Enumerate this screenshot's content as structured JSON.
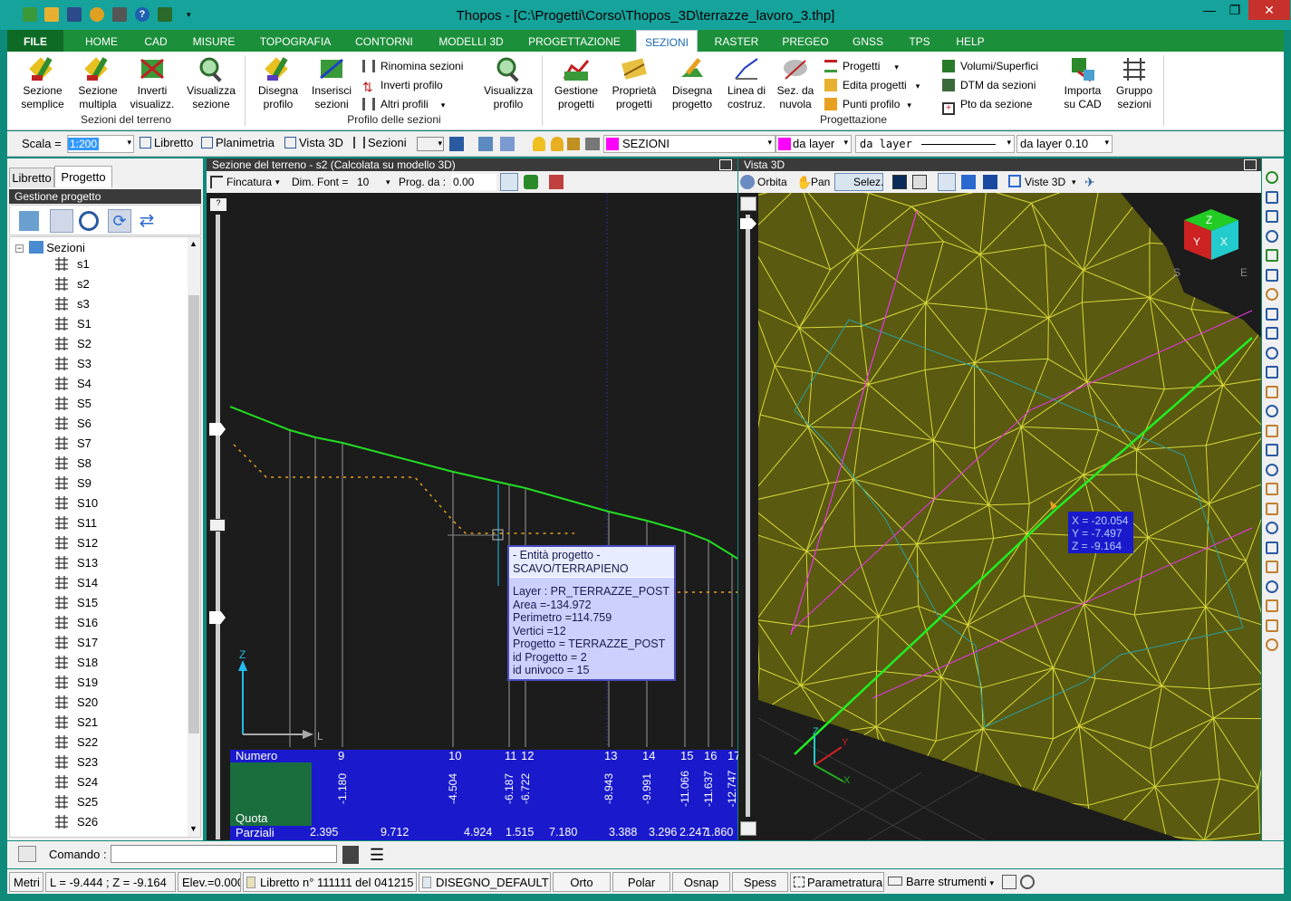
{
  "app": {
    "title": "Thopos - [C:\\Progetti\\Corso\\Thopos_3D\\terrazze_lavoro_3.thp]"
  },
  "window_controls": {
    "minimize": "—",
    "restore": "❐",
    "close": "✕"
  },
  "menu": {
    "tabs": [
      "FILE",
      "HOME",
      "CAD",
      "MISURE",
      "TOPOGRAFIA",
      "CONTORNI",
      "MODELLI 3D",
      "PROGETTAZIONE",
      "SEZIONI",
      "RASTER",
      "PREGEO",
      "GNSS",
      "TPS",
      "HELP"
    ],
    "active": "SEZIONI"
  },
  "ribbon": {
    "g1": {
      "label": "Sezioni del terreno",
      "buttons": [
        [
          "Sezione",
          "semplice"
        ],
        [
          "Sezione",
          "multipla"
        ],
        [
          "Inverti",
          "visualizz."
        ],
        [
          "Visualizza",
          "sezione"
        ]
      ]
    },
    "g2": {
      "label": "Profilo delle sezioni",
      "buttons": [
        [
          "Disegna",
          "profilo"
        ],
        [
          "Inserisci",
          "sezioni"
        ]
      ],
      "small": [
        "Rinomina sezioni",
        "Inverti profilo",
        "Altri profili"
      ],
      "buttons2": [
        [
          "Visualizza",
          "profilo"
        ]
      ]
    },
    "g3": {
      "label": "Progettazione",
      "buttons": [
        [
          "Gestione",
          "progetti"
        ],
        [
          "Proprietà",
          "progetti"
        ],
        [
          "Disegna",
          "progetto"
        ],
        [
          "Linea di",
          "costruz."
        ],
        [
          "Sez. da",
          "nuvola"
        ]
      ],
      "small1": [
        "Progetti",
        "Edita progetti",
        "Punti profilo"
      ],
      "small2": [
        "Volumi/Superfici",
        "DTM da sezioni",
        "Pto da sezione"
      ],
      "buttons2": [
        [
          "Importa",
          "su CAD"
        ],
        [
          "Gruppo",
          "sezioni"
        ]
      ]
    }
  },
  "toolbar": {
    "scala_label": "Scala =",
    "scala_value": "1:200",
    "libretto": "Libretto",
    "planimetria": "Planimetria",
    "vista3d": "Vista 3D",
    "sezioni": "Sezioni",
    "layer_name": "SEZIONI",
    "layer_color": "#ff00ff",
    "color_mode": "da layer",
    "linetype": "da layer",
    "lineweight": "da layer 0.10"
  },
  "left": {
    "tabs": [
      "Libretto",
      "Progetto"
    ],
    "active_tab": "Progetto",
    "header": "Gestione progetto",
    "root": "Sezioni",
    "items": [
      "s1",
      "s2",
      "s3",
      "S1",
      "S2",
      "S3",
      "S4",
      "S5",
      "S6",
      "S7",
      "S8",
      "S9",
      "S10",
      "S11",
      "S12",
      "S13",
      "S14",
      "S15",
      "S16",
      "S17",
      "S18",
      "S19",
      "S20",
      "S21",
      "S22",
      "S23",
      "S24",
      "S25",
      "S26"
    ]
  },
  "section": {
    "title": "Sezione del terreno - s2 (Calcolata su modello 3D)",
    "fincatura": "Fincatura",
    "dimfont_label": "Dim. Font =",
    "dimfont_value": "10",
    "prog_label": "Prog. da :",
    "prog_value": "0.00",
    "axis_z": "Z",
    "axis_l": "L",
    "row_numero": "Numero",
    "row_quota": "Quota",
    "row_parziali": "Parziali",
    "numbers": [
      "9",
      "10",
      "11",
      "12",
      "13",
      "14",
      "15",
      "16",
      "17"
    ],
    "quotas": [
      "-1.180",
      "-4.504",
      "-6.187",
      "-6.722",
      "-8.943",
      "-9.991",
      "-11.066",
      "-11.637",
      "-12.747"
    ],
    "parziali": [
      "2.395",
      "9.712",
      "4.924",
      "1.515",
      "7.180",
      "3.388",
      "3.296",
      "2.247",
      "1.860"
    ],
    "tooltip": {
      "head1": "- Entità progetto -",
      "head2": "SCAVO/TERRAPIENO",
      "lines": [
        "Layer : PR_TERRAZZE_POST",
        "Area =-134.972",
        "Perimetro =114.759",
        "Vertici =12",
        "Progetto = TERRAZZE_POST",
        "id Progetto = 2",
        "id univoco = 15"
      ]
    }
  },
  "view3d": {
    "title": "Vista 3D",
    "orbita": "Orbita",
    "pan": "Pan",
    "selez": "Selez.",
    "viste": "Viste 3D",
    "coords": [
      "X = -20.054",
      "Y = -7.497",
      "Z = -9.164"
    ],
    "mesh_color": "#d8d83a",
    "cube_letters": [
      "Z",
      "Y",
      "X",
      "S",
      "E"
    ],
    "axis_labels": [
      "Z",
      "Y",
      "X"
    ]
  },
  "command": {
    "label": "Comando :",
    "value": ""
  },
  "status": {
    "units": "Metri",
    "coords": "L = -9.444 ; Z = -9.164",
    "elev": "Elev.=0.000",
    "libretto": "Libretto n° 111111 del 041215",
    "disegno": "DISEGNO_DEFAULT",
    "orto": "Orto",
    "polar": "Polar",
    "osnap": "Osnap",
    "spess": "Spess",
    "param": "Parametratura",
    "barre": "Barre strumenti"
  }
}
